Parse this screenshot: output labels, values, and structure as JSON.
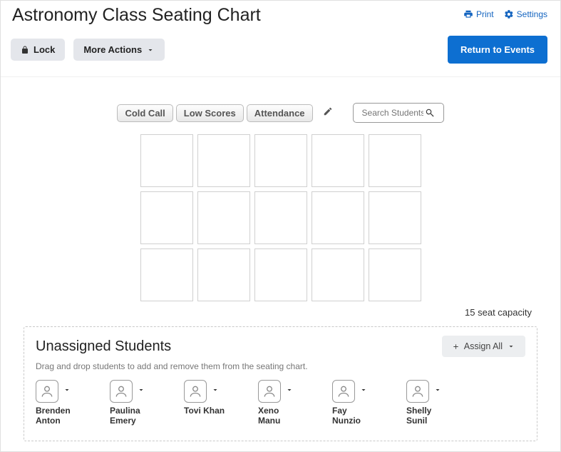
{
  "header": {
    "title": "Astronomy Class Seating Chart",
    "print_label": "Print",
    "settings_label": "Settings"
  },
  "subheader": {
    "lock_label": "Lock",
    "more_actions_label": "More Actions",
    "return_label": "Return to Events"
  },
  "toolbar": {
    "pills": [
      "Cold Call",
      "Low Scores",
      "Attendance"
    ],
    "search_placeholder": "Search Students"
  },
  "grid": {
    "rows": 3,
    "cols": 5
  },
  "capacity_text": "15 seat capacity",
  "unassigned": {
    "title": "Unassigned Students",
    "description": "Drag and drop students to add and remove them from the seating chart.",
    "assign_all_label": "Assign All",
    "students": [
      {
        "name": "Brenden Anton"
      },
      {
        "name": "Paulina Emery"
      },
      {
        "name": "Tovi Khan"
      },
      {
        "name": "Xeno Manu"
      },
      {
        "name": "Fay Nunzio"
      },
      {
        "name": "Shelly Sunil"
      }
    ]
  }
}
